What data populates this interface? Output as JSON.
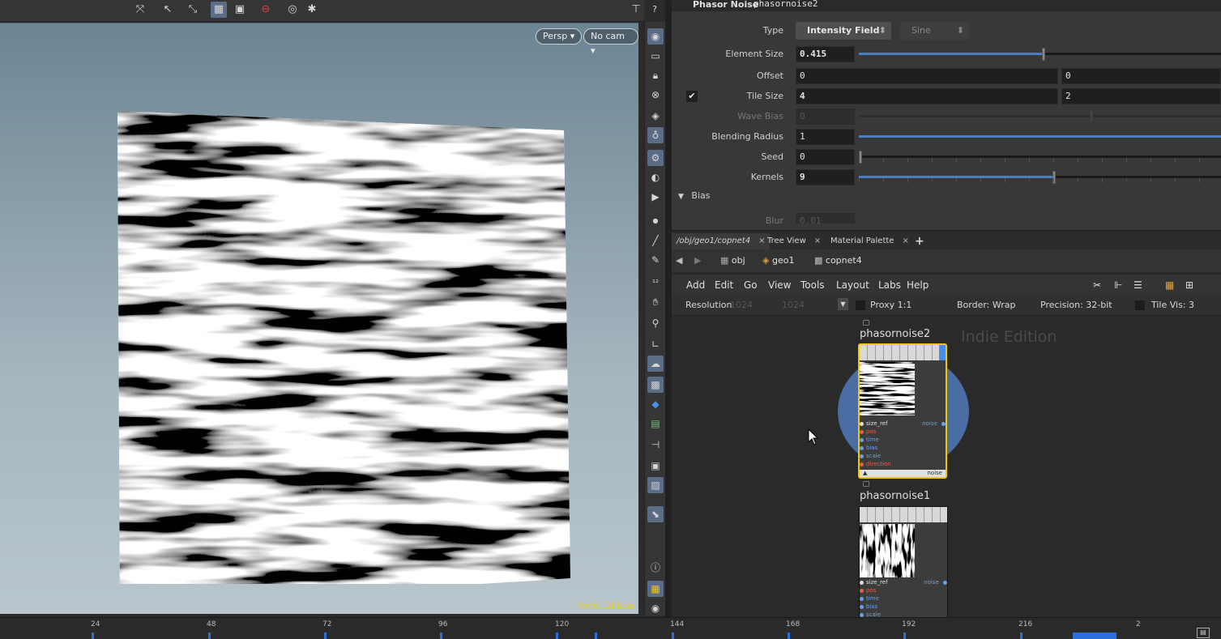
{
  "viewport": {
    "persp_label": "Persp ▾",
    "cam_label": "No cam ▾",
    "watermark": "Indie Edition"
  },
  "params": {
    "node_type": "Phasor Noise",
    "node_name": "phasornoise2",
    "type_label": "Type",
    "type_value": "Intensity Field",
    "type_second": "Sine",
    "element_size_label": "Element Size",
    "element_size_value": "0.415",
    "element_size_fraction": 0.51,
    "offset_label": "Offset",
    "offset_x": "0",
    "offset_y": "0",
    "tile_size_label": "Tile Size",
    "tile_size_enabled": true,
    "tile_size_x": "4",
    "tile_size_y": "2",
    "wave_bias_label": "Wave Bias",
    "wave_bias_value": "0",
    "blending_radius_label": "Blending Radius",
    "blending_radius_value": "1",
    "seed_label": "Seed",
    "seed_value": "0",
    "kernels_label": "Kernels",
    "kernels_value": "9",
    "kernels_fraction": 0.54,
    "bias_folder": "Bias",
    "blur_label": "Blur",
    "blur_value": "0.01"
  },
  "tabs": [
    {
      "label": "/obj/geo1/copnet4"
    },
    {
      "label": "Tree View"
    },
    {
      "label": "Material Palette"
    }
  ],
  "path": {
    "obj": "obj",
    "geo": "geo1",
    "net": "copnet4"
  },
  "netmenu": [
    "Add",
    "Edit",
    "Go",
    "View",
    "Tools",
    "Layout",
    "Labs",
    "Help"
  ],
  "netopts": {
    "resolution_label": "Resolution",
    "res_x": "1024",
    "res_y": "1024",
    "proxy": "Proxy 1:1",
    "border": "Border: Wrap",
    "precision": "Precision: 32-bit",
    "tile_vis": "Tile Vis: 3"
  },
  "network": {
    "watermark": "Indie Edition",
    "node2": {
      "name": "phasornoise2",
      "inputs": [
        "size_ref",
        "pos",
        "time",
        "bias",
        "scale",
        "direction"
      ],
      "output": "noise",
      "footer": "noise"
    },
    "node1": {
      "name": "phasornoise1",
      "inputs": [
        "size_ref",
        "pos",
        "time",
        "bias",
        "scale"
      ],
      "output": "noise"
    }
  },
  "timeline": {
    "ticks": [
      "24",
      "48",
      "72",
      "96",
      "120",
      "144",
      "168",
      "192",
      "216",
      "2"
    ]
  },
  "colors": {
    "accent": "#4a7ec4",
    "selection": "#f0c800",
    "indie": "#e8d22c"
  }
}
